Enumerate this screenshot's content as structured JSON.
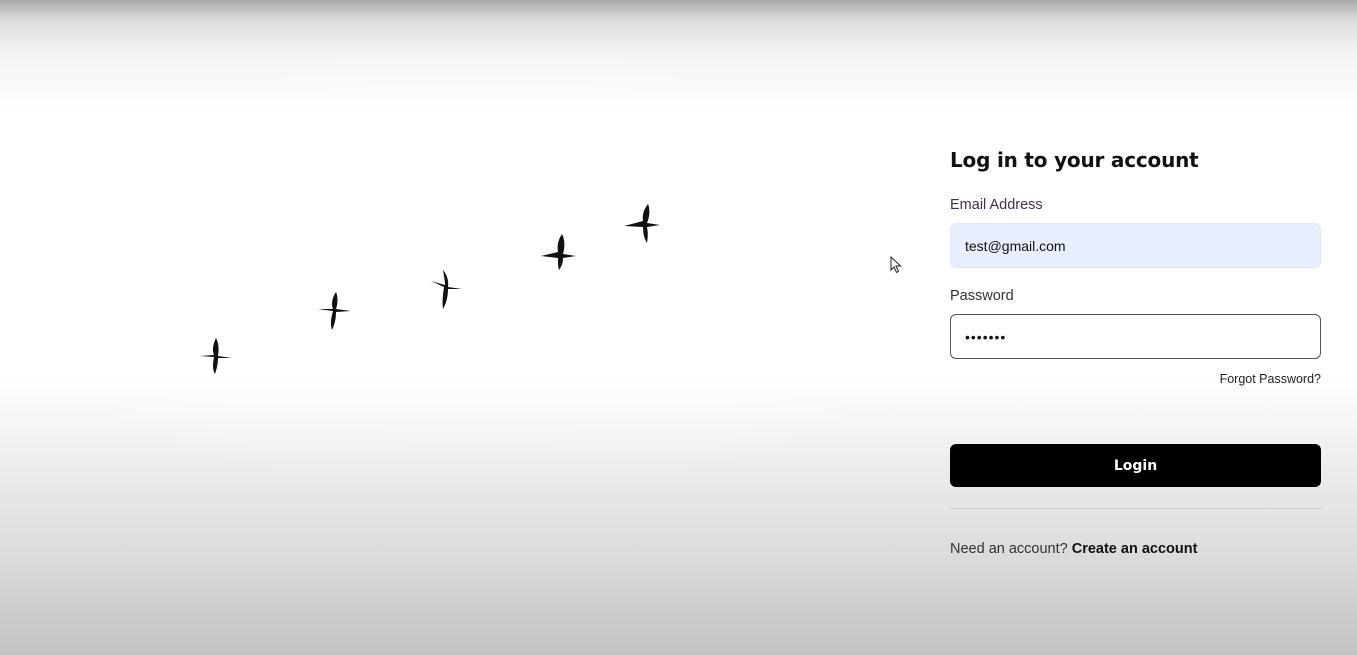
{
  "hero": {
    "icon": "flying-birds-image"
  },
  "form": {
    "title": "Log in to your account",
    "email_label": "Email Address",
    "email_value": "test@gmail.com",
    "password_label": "Password",
    "password_value": "•••••••",
    "forgot_label": "Forgot Password?",
    "login_label": "Login",
    "signup_prompt": "Need an account?",
    "signup_link": "Create an account"
  },
  "colors": {
    "email_field_bg": "#e8eefd",
    "login_button_bg": "#000000",
    "login_button_text": "#ffffff"
  }
}
